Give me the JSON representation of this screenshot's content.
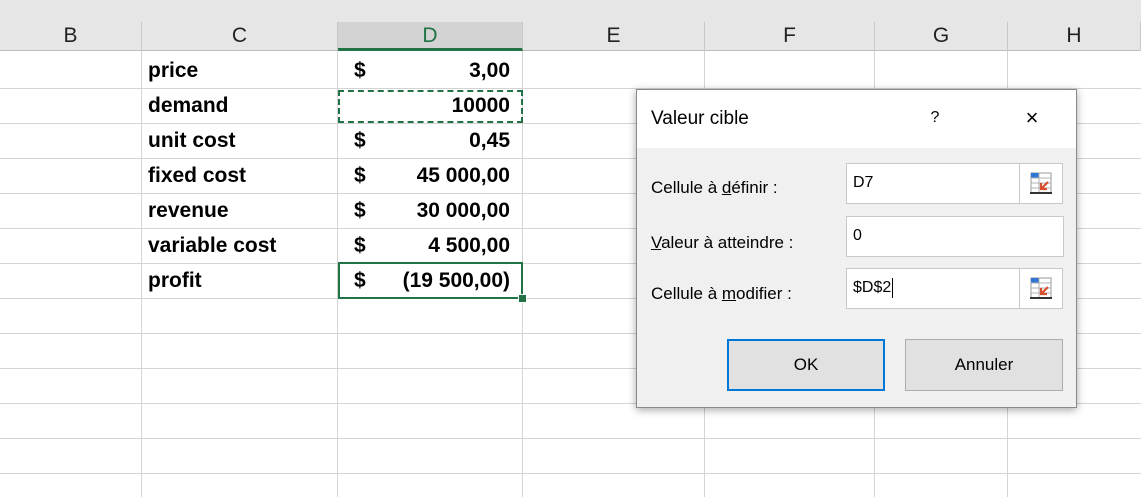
{
  "columns": {
    "B": "B",
    "C": "C",
    "D": "D",
    "E": "E",
    "F": "F",
    "G": "G",
    "H": "H",
    "selected": "D"
  },
  "rows": [
    {
      "label": "price",
      "currency": "$",
      "value": "3,00"
    },
    {
      "label": "demand",
      "currency": "",
      "value": "10000"
    },
    {
      "label": "unit cost",
      "currency": "$",
      "value": "0,45"
    },
    {
      "label": "fixed cost",
      "currency": "$",
      "value": "45 000,00"
    },
    {
      "label": "revenue",
      "currency": "$",
      "value": "30 000,00"
    },
    {
      "label": "variable cost",
      "currency": "$",
      "value": "4 500,00"
    },
    {
      "label": "profit",
      "currency": "$",
      "value": "(19 500,00)"
    }
  ],
  "dialog": {
    "title": "Valeur cible",
    "help": "?",
    "close": "×",
    "set_cell_label_pre": "Cellule à ",
    "set_cell_label_u": "d",
    "set_cell_label_post": "éfinir :",
    "set_cell_value": "D7",
    "to_value_label_u": "V",
    "to_value_label_post": "aleur à atteindre :",
    "to_value_value": "0",
    "changing_cell_label_pre": "Cellule à ",
    "changing_cell_label_u": "m",
    "changing_cell_label_post": "odifier :",
    "changing_cell_value": "$D$2",
    "ok_label": "OK",
    "cancel_label": "Annuler"
  },
  "colors": {
    "excel_green": "#217346",
    "focus_blue": "#0078d7"
  },
  "icons": {
    "ref_button": "collapse-dialog-range-icon"
  }
}
